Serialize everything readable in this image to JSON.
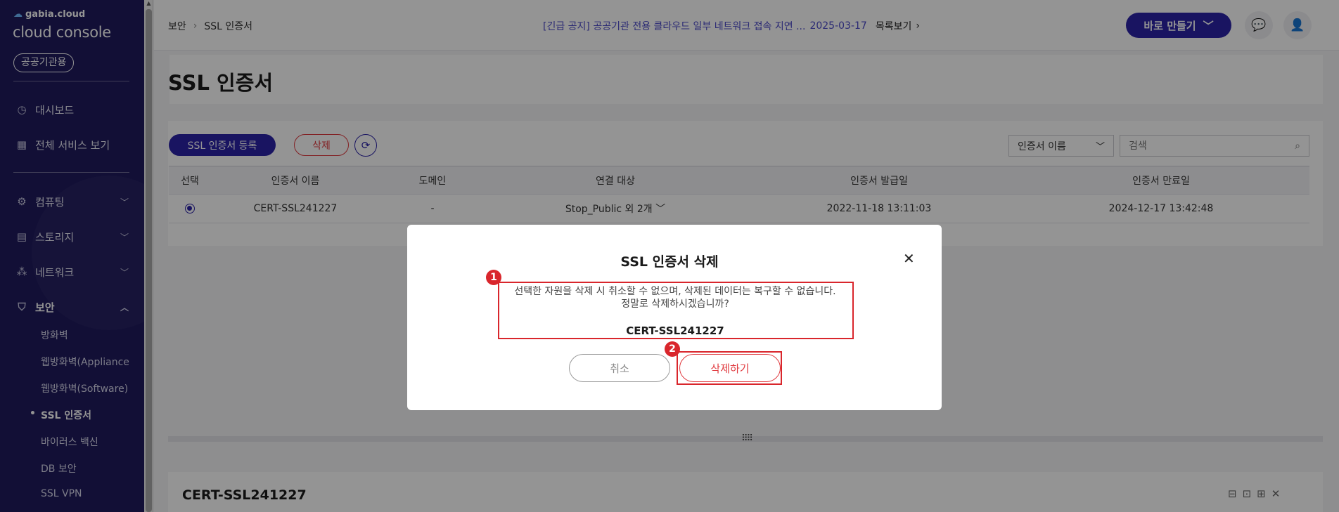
{
  "sidebar": {
    "brand_small": "gabia.cloud",
    "brand_big": "cloud console",
    "badge": "공공기관용",
    "nav": [
      {
        "label": "대시보드",
        "icon": "dashboard-icon"
      },
      {
        "label": "전체 서비스 보기",
        "icon": "grid-icon"
      },
      {
        "label": "컴퓨팅",
        "icon": "cpu-icon"
      },
      {
        "label": "스토리지",
        "icon": "storage-icon"
      },
      {
        "label": "네트워크",
        "icon": "network-icon"
      },
      {
        "label": "보안",
        "icon": "shield-icon"
      }
    ],
    "security_sub": [
      {
        "label": "방화벽"
      },
      {
        "label": "웹방화벽(Appliance"
      },
      {
        "label": "웹방화벽(Software)"
      },
      {
        "label": "SSL 인증서"
      },
      {
        "label": "바이러스 백신"
      },
      {
        "label": "DB 보안"
      },
      {
        "label": "SSL VPN"
      }
    ]
  },
  "topbar": {
    "breadcrumb": [
      "보안",
      "SSL 인증서"
    ],
    "notice_text": "[긴급 공지] 공공기관 전용 클라우드 일부 네트워크 접속 지연 ...",
    "notice_date": "2025-03-17",
    "notice_more": "목록보기",
    "create_button": "바로 만들기"
  },
  "page": {
    "title": "SSL 인증서",
    "register_button": "SSL 인증서 등록",
    "delete_button": "삭제",
    "filter_selected": "인증서 이름",
    "search_placeholder": "검색"
  },
  "table": {
    "headers": [
      "선택",
      "인증서 이름",
      "도메인",
      "연결 대상",
      "인증서 발급일",
      "인증서 만료일"
    ],
    "rows": [
      {
        "name": "CERT-SSL241227",
        "domain": "-",
        "target": "Stop_Public 외 2개",
        "issued": "2022-11-18 13:11:03",
        "expires": "2024-12-17 13:42:48"
      }
    ]
  },
  "detail": {
    "title": "CERT-SSL241227"
  },
  "modal": {
    "title": "SSL 인증서 삭제",
    "message_line1": "선택한 자원을 삭제 시 취소할 수 없으며, 삭제된 데이터는 복구할 수 없습니다.",
    "message_line2": "정말로 삭제하시겠습니까?",
    "cert_name": "CERT-SSL241227",
    "cancel_button": "취소",
    "confirm_button": "삭제하기",
    "step1": "1",
    "step2": "2"
  },
  "colors": {
    "sidebar_bg": "#1f1a5e",
    "brand_primary": "#2b23a8",
    "danger": "#e0393e",
    "annotation": "#d9262c"
  }
}
